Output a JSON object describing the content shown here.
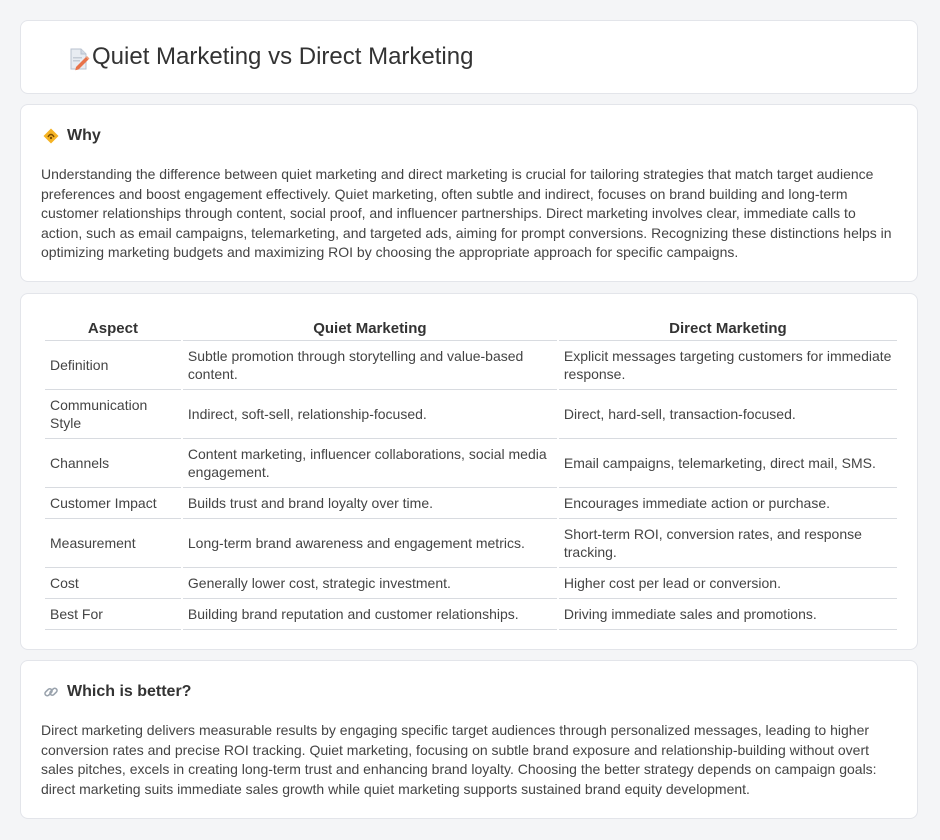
{
  "header": {
    "title": "Quiet Marketing vs Direct Marketing",
    "icon": "document-pencil-icon"
  },
  "why": {
    "title": "Why",
    "icon": "diamond-signal-icon",
    "text": "Understanding the difference between quiet marketing and direct marketing is crucial for tailoring strategies that match target audience preferences and boost engagement effectively. Quiet marketing, often subtle and indirect, focuses on brand building and long-term customer relationships through content, social proof, and influencer partnerships. Direct marketing involves clear, immediate calls to action, such as email campaigns, telemarketing, and targeted ads, aiming for prompt conversions. Recognizing these distinctions helps in optimizing marketing budgets and maximizing ROI by choosing the appropriate approach for specific campaigns."
  },
  "comparison": {
    "headers": [
      "Aspect",
      "Quiet Marketing",
      "Direct Marketing"
    ],
    "rows": [
      [
        "Definition",
        "Subtle promotion through storytelling and value-based content.",
        "Explicit messages targeting customers for immediate response."
      ],
      [
        "Communication Style",
        "Indirect, soft-sell, relationship-focused.",
        "Direct, hard-sell, transaction-focused."
      ],
      [
        "Channels",
        "Content marketing, influencer collaborations, social media engagement.",
        "Email campaigns, telemarketing, direct mail, SMS."
      ],
      [
        "Customer Impact",
        "Builds trust and brand loyalty over time.",
        "Encourages immediate action or purchase."
      ],
      [
        "Measurement",
        "Long-term brand awareness and engagement metrics.",
        "Short-term ROI, conversion rates, and response tracking."
      ],
      [
        "Cost",
        "Generally lower cost, strategic investment.",
        "Higher cost per lead or conversion."
      ],
      [
        "Best For",
        "Building brand reputation and customer relationships.",
        "Driving immediate sales and promotions."
      ]
    ]
  },
  "better": {
    "title": "Which is better?",
    "icon": "link-icon",
    "text": "Direct marketing delivers measurable results by engaging specific target audiences through personalized messages, leading to higher conversion rates and precise ROI tracking. Quiet marketing, focusing on subtle brand exposure and relationship-building without overt sales pitches, excels in creating long-term trust and enhancing brand loyalty. Choosing the better strategy depends on campaign goals: direct marketing suits immediate sales growth while quiet marketing supports sustained brand equity development."
  }
}
